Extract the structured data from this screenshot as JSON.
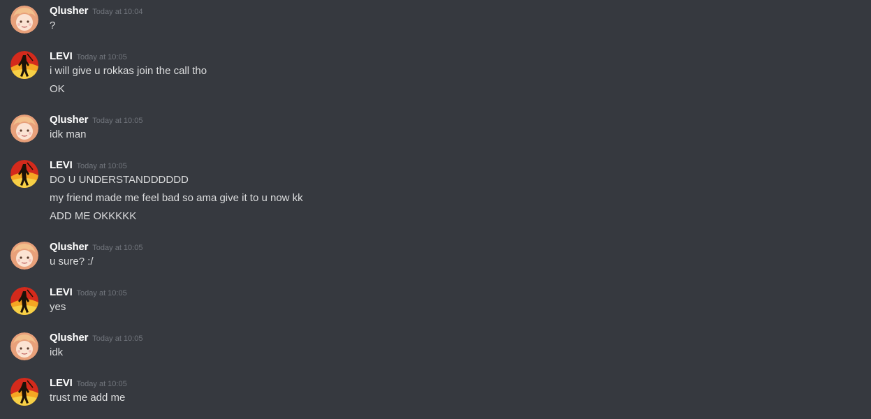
{
  "colors": {
    "background": "#36393f",
    "username": "#ffffff",
    "timestamp": "#72767d",
    "message_text": "#dcddde"
  },
  "messages": [
    {
      "author": "Qlusher",
      "timestamp": "Today at 10:04",
      "avatar": "qlusher-avatar-icon",
      "lines": [
        "?"
      ]
    },
    {
      "author": "LEVI",
      "timestamp": "Today at 10:05",
      "avatar": "levi-avatar-icon",
      "lines": [
        "i will give u rokkas join the call tho",
        "OK"
      ]
    },
    {
      "author": "Qlusher",
      "timestamp": "Today at 10:05",
      "avatar": "qlusher-avatar-icon",
      "lines": [
        "idk man"
      ]
    },
    {
      "author": "LEVI",
      "timestamp": "Today at 10:05",
      "avatar": "levi-avatar-icon",
      "lines": [
        "DO U UNDERSTANDDDDDD",
        "my friend made me feel bad so ama give it to u now kk",
        "ADD ME OKKKKK"
      ]
    },
    {
      "author": "Qlusher",
      "timestamp": "Today at 10:05",
      "avatar": "qlusher-avatar-icon",
      "lines": [
        "u sure? :/"
      ]
    },
    {
      "author": "LEVI",
      "timestamp": "Today at 10:05",
      "avatar": "levi-avatar-icon",
      "lines": [
        "yes"
      ]
    },
    {
      "author": "Qlusher",
      "timestamp": "Today at 10:05",
      "avatar": "qlusher-avatar-icon",
      "lines": [
        "idk"
      ]
    },
    {
      "author": "LEVI",
      "timestamp": "Today at 10:05",
      "avatar": "levi-avatar-icon",
      "lines": [
        "trust me add me"
      ]
    }
  ]
}
